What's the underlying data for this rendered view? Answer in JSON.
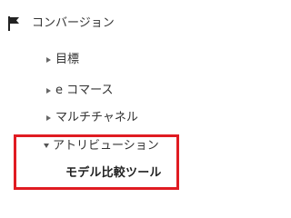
{
  "nav": {
    "section": {
      "label": "コンバージョン",
      "icon": "flag-icon"
    },
    "items": [
      {
        "label": "目標",
        "icon": "chevron-right-icon",
        "expanded": false
      },
      {
        "label": "e コマース",
        "icon": "chevron-right-icon",
        "expanded": false
      },
      {
        "label": "マルチチャネル",
        "icon": "chevron-right-icon",
        "expanded": false
      },
      {
        "label": "アトリビューション",
        "icon": "chevron-down-icon",
        "expanded": true,
        "children": [
          {
            "label": "モデル比較ツール",
            "selected": true
          }
        ]
      }
    ]
  },
  "colors": {
    "highlight": "#e01b22",
    "text": "#333333",
    "arrow": "#666666"
  }
}
